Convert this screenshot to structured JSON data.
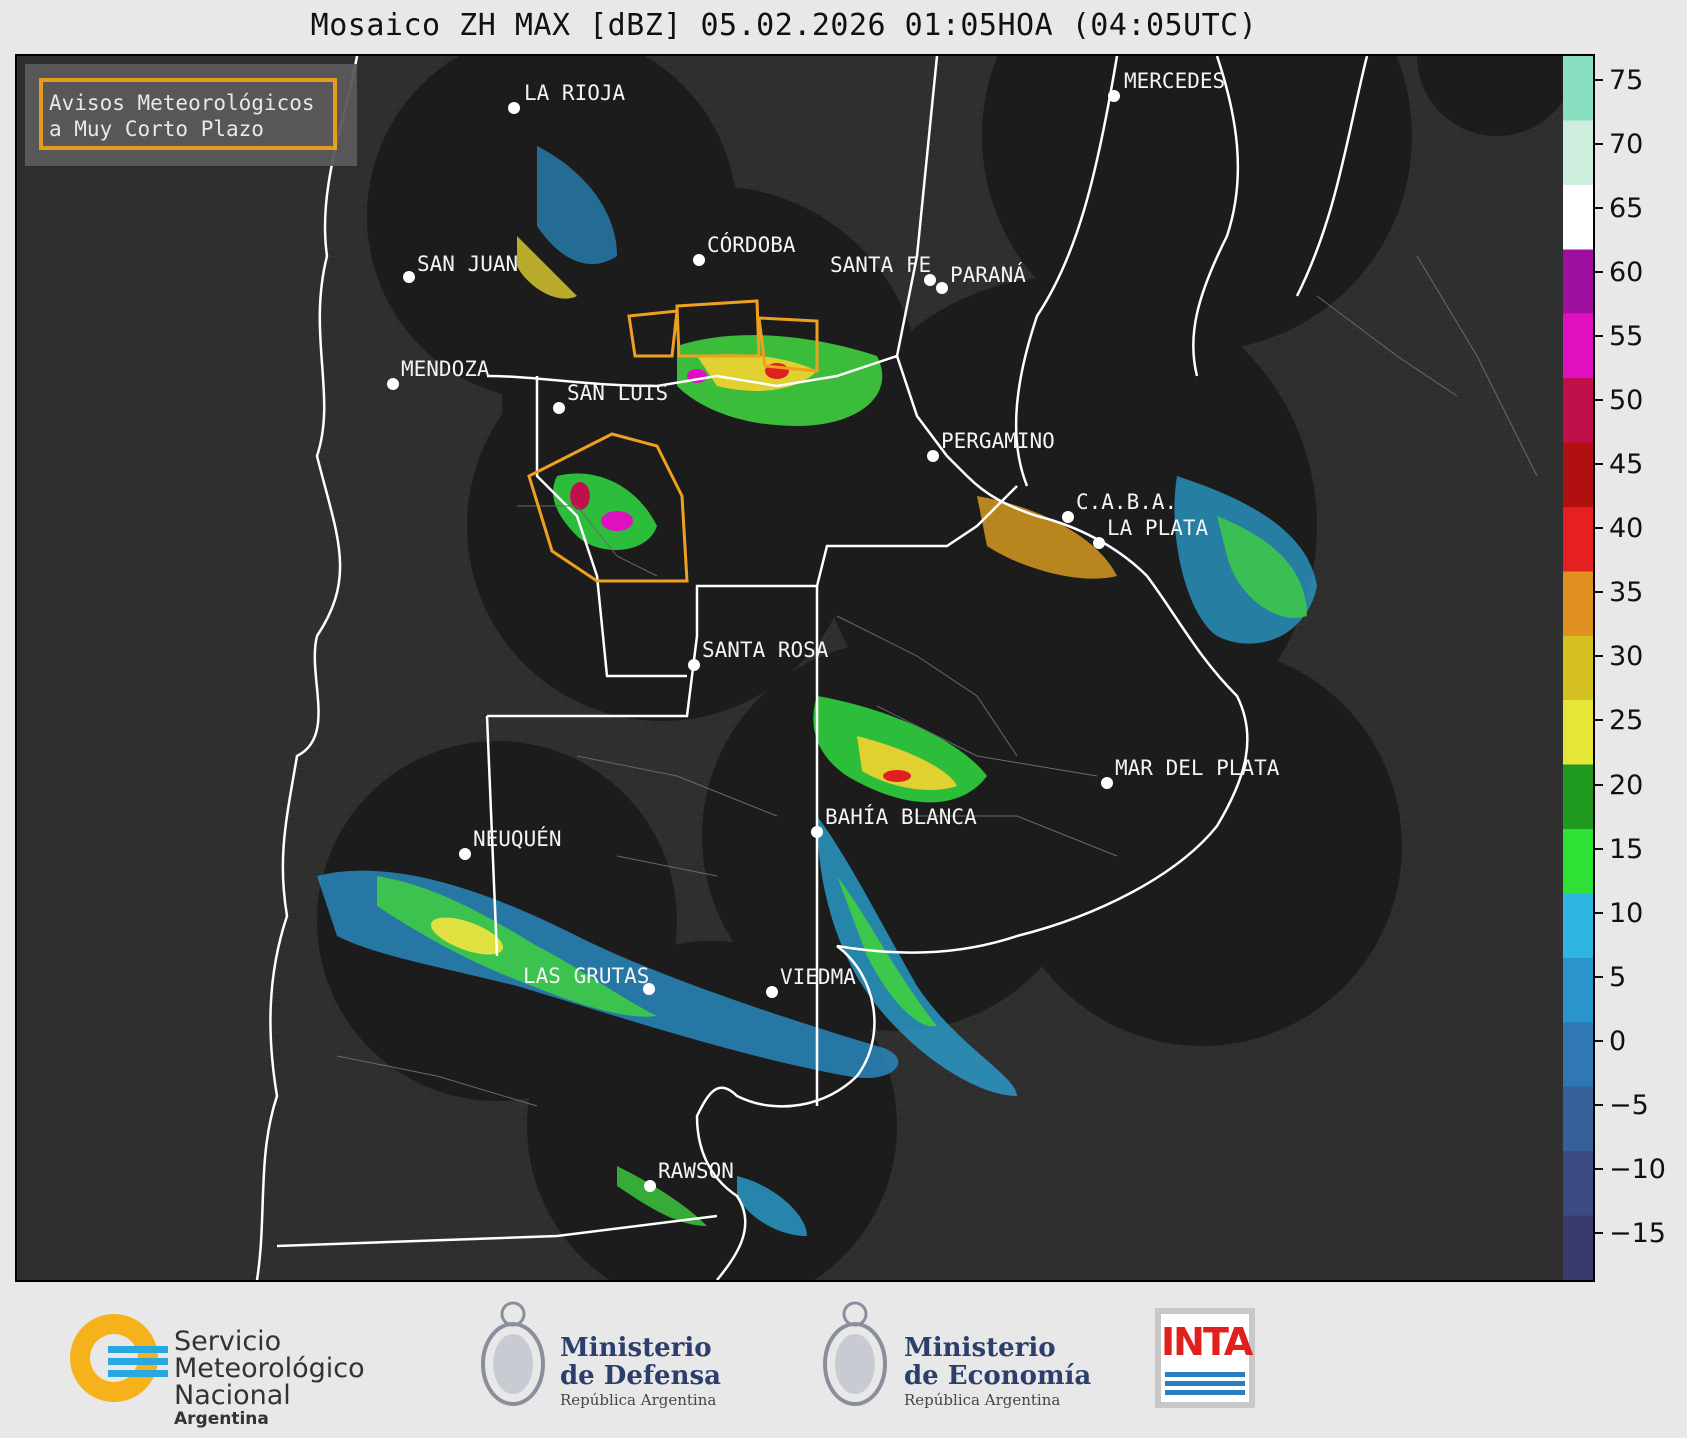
{
  "title": "Mosaico ZH MAX [dBZ] 05.02.2026 01:05HOA (04:05UTC)",
  "legend_box": {
    "line1": "Avisos Meteorológicos",
    "line2": "a Muy Corto Plazo"
  },
  "colorbar": {
    "ticks": [
      "75",
      "70",
      "65",
      "60",
      "55",
      "50",
      "45",
      "40",
      "35",
      "30",
      "25",
      "20",
      "15",
      "10",
      "5",
      "0",
      "−5",
      "−10",
      "−15"
    ],
    "range": [
      -18.5,
      77
    ],
    "colors": [
      "#3a3a6e",
      "#3b4a82",
      "#35609a",
      "#2f78b4",
      "#2a95cc",
      "#2fb6e0",
      "#2fe035",
      "#1f9a1f",
      "#e6e638",
      "#d4c020",
      "#e09020",
      "#e62020",
      "#b01010",
      "#c0104c",
      "#e010c0",
      "#a010a0",
      "#ffffff",
      "#cdeedd",
      "#88e0c0"
    ]
  },
  "cities": [
    {
      "name": "LA RIOJA"
    },
    {
      "name": "SAN JUAN"
    },
    {
      "name": "CÓRDOBA"
    },
    {
      "name": "SANTA FE"
    },
    {
      "name": "PARANÁ"
    },
    {
      "name": "MERCEDES"
    },
    {
      "name": "MENDOZA"
    },
    {
      "name": "SAN LUIS"
    },
    {
      "name": "PERGAMINO"
    },
    {
      "name": "C.A.B.A."
    },
    {
      "name": "LA PLATA"
    },
    {
      "name": "SANTA ROSA"
    },
    {
      "name": "MAR DEL PLATA"
    },
    {
      "name": "BAHÍA BLANCA"
    },
    {
      "name": "NEUQUÉN"
    },
    {
      "name": "LAS GRUTAS"
    },
    {
      "name": "VIEDMA"
    },
    {
      "name": "RAWSON"
    }
  ],
  "logos": {
    "smn": {
      "line1": "Servicio",
      "line2": "Meteorológico",
      "line3": "Nacional",
      "line4": "Argentina"
    },
    "defensa": {
      "line1": "Ministerio",
      "line2": "de Defensa",
      "line3": "República Argentina"
    },
    "economia": {
      "line1": "Ministerio",
      "line2": "de Economía",
      "line3": "República Argentina"
    },
    "inta": {
      "text": "INTA"
    }
  }
}
